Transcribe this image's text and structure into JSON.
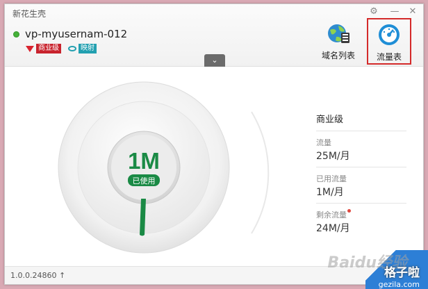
{
  "app": {
    "title": "新花生壳"
  },
  "window_controls": {
    "settings": "⚙",
    "minimize": "—",
    "close": "✕"
  },
  "host": {
    "name": "vp-myusernam-012",
    "status": "online",
    "status_color": "#46b33a"
  },
  "badges": [
    {
      "label": "商业级",
      "color": "#c8232d"
    },
    {
      "label": "映射",
      "color": "#23a0b0"
    }
  ],
  "toolbar": [
    {
      "label": "域名列表",
      "icon": "globe-icon",
      "selected": false
    },
    {
      "label": "流量表",
      "icon": "gauge-icon",
      "selected": true
    }
  ],
  "collapse": {
    "glyph": "⌄"
  },
  "gauge": {
    "used_value": "1M",
    "used_label": "已使用",
    "accent": "#1a8a45"
  },
  "plan": {
    "name": "商业级"
  },
  "stats": [
    {
      "label": "流量",
      "value": "25M/月",
      "marker": false
    },
    {
      "label": "已用流量",
      "value": "1M/月",
      "marker": false
    },
    {
      "label": "剩余流量",
      "value": "24M/月",
      "marker": true
    }
  ],
  "footer": {
    "version": "1.0.0.24860",
    "upgrade_glyph": "↑"
  },
  "watermark": {
    "text1": "Baidu经验",
    "text2": "格子啦",
    "text3": "gezila.com"
  }
}
